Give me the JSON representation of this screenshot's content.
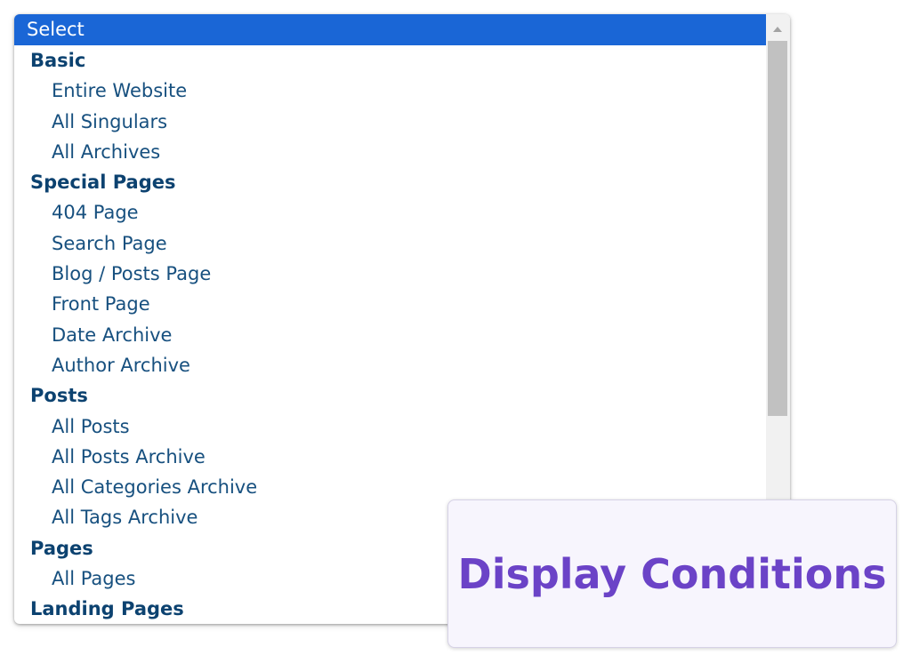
{
  "select": {
    "selected_label": "Select",
    "groups": [
      {
        "label": "Basic",
        "options": [
          "Entire Website",
          "All Singulars",
          "All Archives"
        ]
      },
      {
        "label": "Special Pages",
        "options": [
          "404 Page",
          "Search Page",
          "Blog / Posts Page",
          "Front Page",
          "Date Archive",
          "Author Archive"
        ]
      },
      {
        "label": "Posts",
        "options": [
          "All Posts",
          "All Posts Archive",
          "All Categories Archive",
          "All Tags Archive"
        ]
      },
      {
        "label": "Pages",
        "options": [
          "All Pages"
        ]
      },
      {
        "label": "Landing Pages",
        "options": []
      }
    ]
  },
  "badge": {
    "label": "Display Conditions"
  },
  "colors": {
    "selected_bg": "#1a66d6",
    "group_text": "#0c4270",
    "option_text": "#17507f",
    "badge_text": "#6b43c7",
    "badge_bg": "#f7f5fd"
  }
}
